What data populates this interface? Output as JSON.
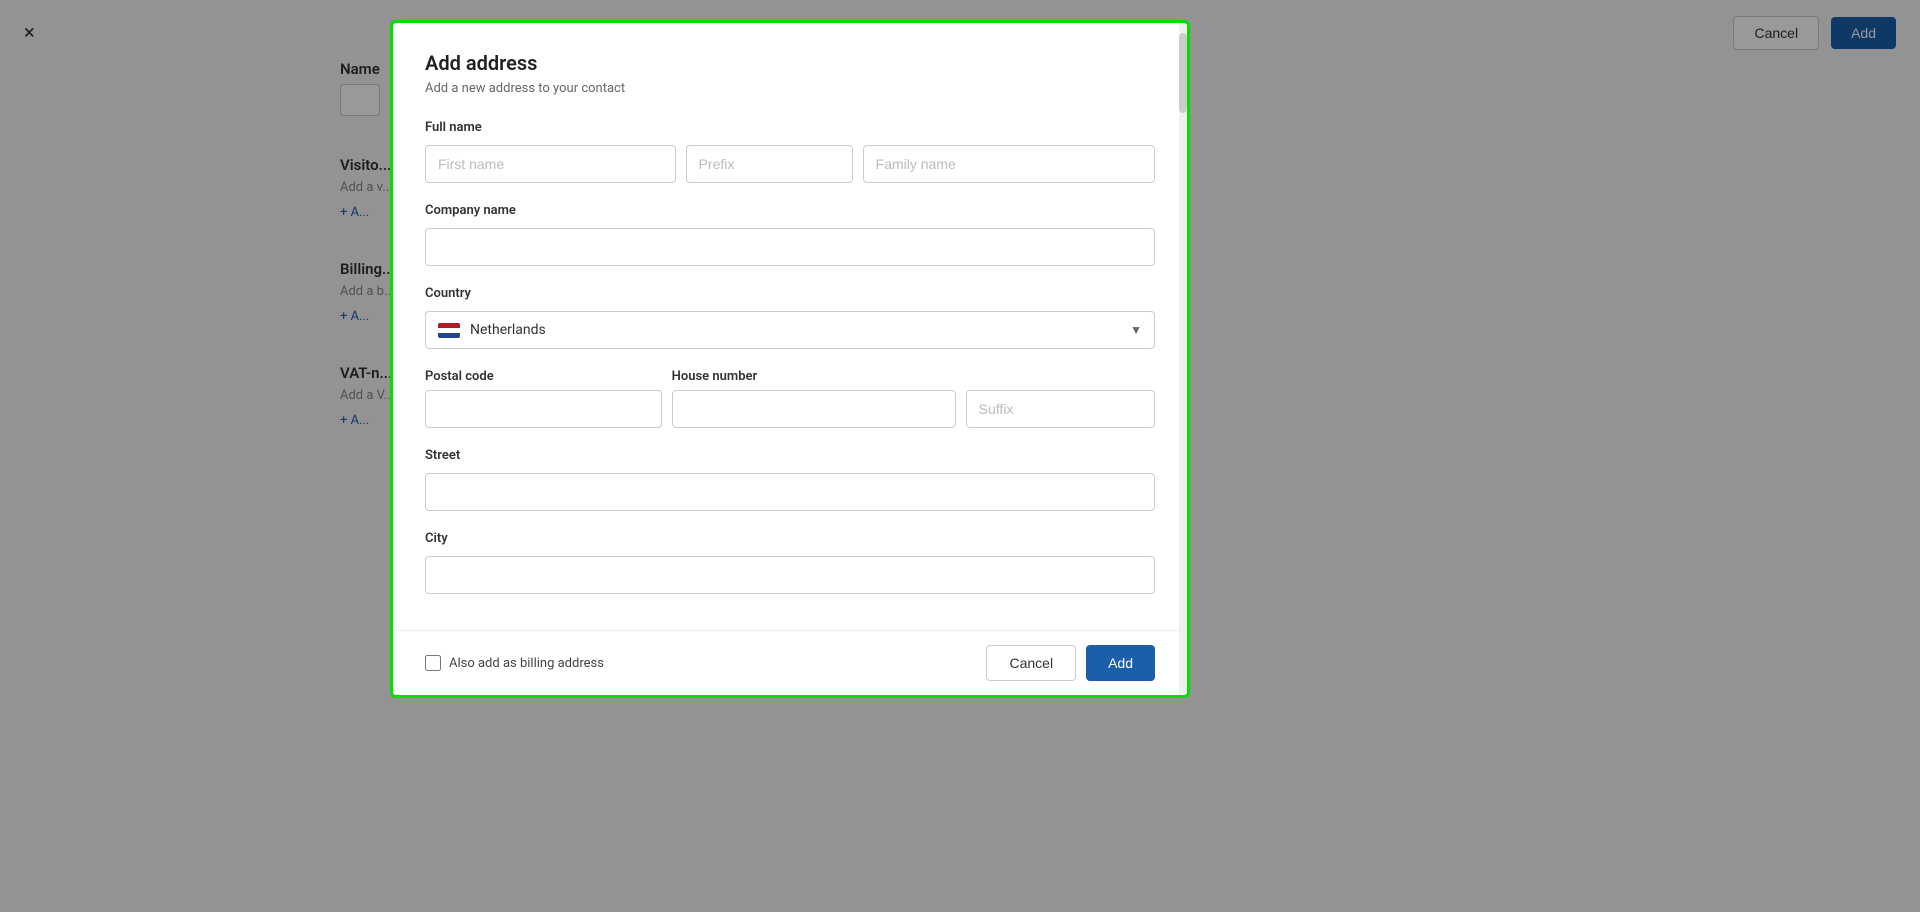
{
  "page": {
    "background": {
      "close_icon": "×",
      "topbar": {
        "cancel_label": "Cancel",
        "add_label": "Add"
      },
      "sections": [
        {
          "label": "Name",
          "sub": "",
          "add_link": "+ A..."
        },
        {
          "label": "Visito...",
          "sub": "Add a v...",
          "add_link": "+ A..."
        },
        {
          "label": "Billing...",
          "sub": "Add a b...",
          "add_link": "+ A..."
        },
        {
          "label": "VAT-n...",
          "sub": "Add a V...",
          "add_link": "+ A..."
        }
      ]
    },
    "modal": {
      "title": "Add address",
      "subtitle": "Add a new address to your contact",
      "form": {
        "full_name_label": "Full name",
        "first_name_placeholder": "First name",
        "prefix_placeholder": "Prefix",
        "family_name_placeholder": "Family name",
        "company_name_label": "Company name",
        "company_name_placeholder": "",
        "country_label": "Country",
        "country_value": "Netherlands",
        "country_flag": "NL",
        "postal_code_label": "Postal code",
        "postal_code_placeholder": "",
        "house_number_label": "House number",
        "house_number_placeholder": "",
        "suffix_placeholder": "Suffix",
        "street_label": "Street",
        "street_placeholder": "",
        "city_label": "City",
        "city_placeholder": ""
      },
      "footer": {
        "checkbox_label": "Also add as billing address",
        "checkbox_checked": false,
        "cancel_label": "Cancel",
        "add_label": "Add"
      }
    }
  }
}
